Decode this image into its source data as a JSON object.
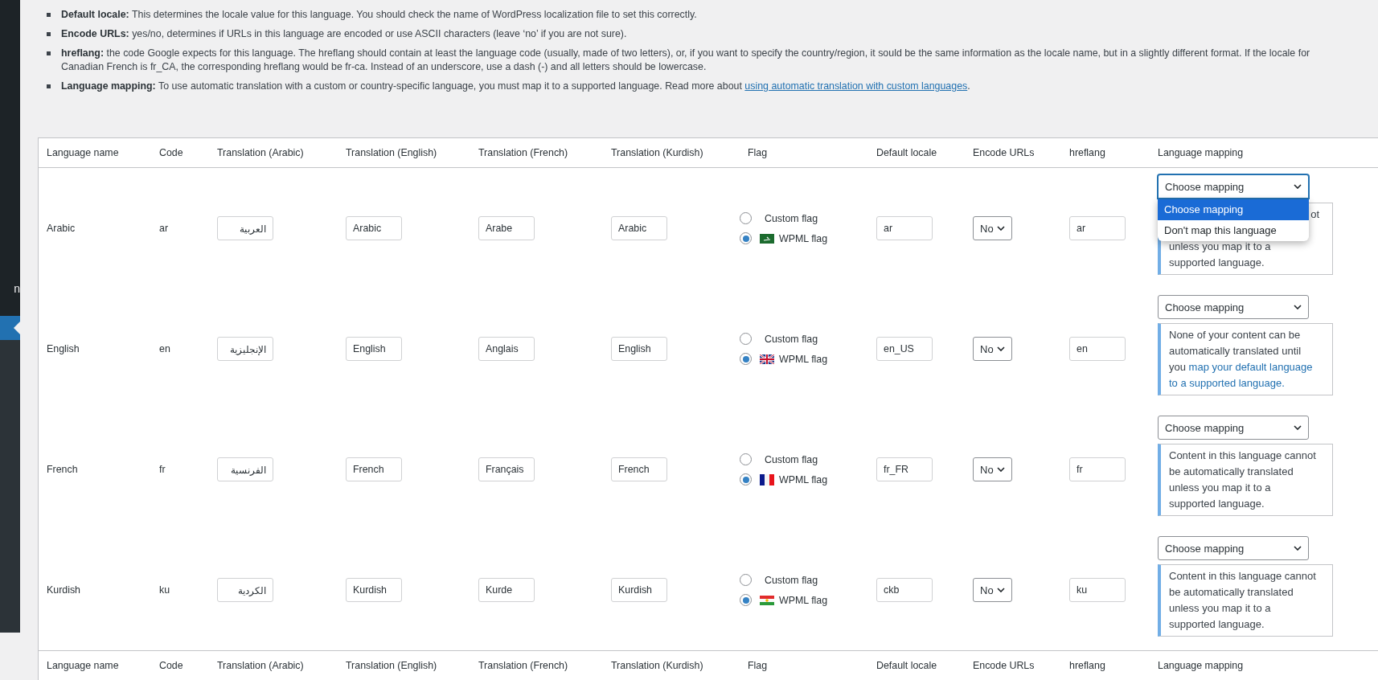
{
  "sidebar": {
    "items": [
      {
        "label": "n",
        "selected": false
      },
      {
        "selected": true
      }
    ]
  },
  "description": [
    {
      "term": "Default locale:",
      "text": "This determines the locale value for this language. You should check the name of WordPress localization file to set this correctly."
    },
    {
      "term": "Encode URLs:",
      "text": "yes/no, determines if URLs in this language are encoded or use ASCII characters (leave ‘no’ if you are not sure)."
    },
    {
      "term": "hreflang:",
      "text": "the code Google expects for this language. The hreflang should contain at least the language code (usually, made of two letters), or, if you want to specify the country/region, it sould be the same information as the locale name, but in a slightly different format. If the locale for\nCanadian French is fr_CA, the corresponding hreflang would be fr-ca. Instead of an underscore, use a dash (-) and all letters should be lowercase."
    },
    {
      "term": "Language mapping:",
      "text": "To use automatic translation with a custom or country-specific language, you must map it to a supported language. Read more about",
      "link": "using automatic translation with custom languages",
      "after": "."
    }
  ],
  "table": {
    "columns": [
      "Language name",
      "Code",
      "Translation (Arabic)",
      "Translation (English)",
      "Translation (French)",
      "Translation (Kurdish)",
      "Flag",
      "Default locale",
      "Encode URLs",
      "hreflang",
      "Language mapping"
    ],
    "rows": [
      {
        "name": "Arabic",
        "code": "ar",
        "translations": [
          "العربية",
          "Arabic",
          "Arabe",
          "Arabic"
        ],
        "flag_options": [
          {
            "label": "Custom flag",
            "selected": false
          },
          {
            "label": "WPML flag",
            "selected": true,
            "kind": "saudi"
          }
        ],
        "locale": "ar",
        "encode_urls": "No",
        "hreflang": "ar",
        "mapping": {
          "value": "Choose mapping",
          "focused": true,
          "open": true,
          "options": [
            {
              "label": "Choose mapping",
              "selected": true
            },
            {
              "label": "Don't map this language",
              "selected": false
            }
          ]
        },
        "note": {
          "fragment": "ot",
          "text": "unless you map it to a supported language."
        }
      },
      {
        "name": "English",
        "code": "en",
        "translations": [
          "الإنجليزية",
          "English",
          "Anglais",
          "English"
        ],
        "flag_options": [
          {
            "label": "Custom flag",
            "selected": false
          },
          {
            "label": "WPML flag",
            "selected": true,
            "kind": "uk"
          }
        ],
        "locale": "en_US",
        "encode_urls": "No",
        "hreflang": "en",
        "mapping": {
          "value": "Choose mapping",
          "focused": false
        },
        "note": {
          "text": "None of your content can be automatically translated until you",
          "link": [
            "map your default language",
            "to a supported language."
          ]
        }
      },
      {
        "name": "French",
        "code": "fr",
        "translations": [
          "الفرنسية",
          "French",
          "Français",
          "French"
        ],
        "flag_options": [
          {
            "label": "Custom flag",
            "selected": false
          },
          {
            "label": "WPML flag",
            "selected": true,
            "kind": "france"
          }
        ],
        "locale": "fr_FR",
        "encode_urls": "No",
        "hreflang": "fr",
        "mapping": {
          "value": "Choose mapping",
          "focused": false
        },
        "note": {
          "text": "Content in this language cannot be automatically translated unless you map it to a supported language."
        }
      },
      {
        "name": "Kurdish",
        "code": "ku",
        "translations": [
          "الكردية",
          "Kurdish",
          "Kurde",
          "Kurdish"
        ],
        "flag_options": [
          {
            "label": "Custom flag",
            "selected": false
          },
          {
            "label": "WPML flag",
            "selected": true,
            "kind": "kurdistan"
          }
        ],
        "locale": "ckb",
        "encode_urls": "No",
        "hreflang": "ku",
        "mapping": {
          "value": "Choose mapping",
          "focused": false
        },
        "note": {
          "text": "Content in this language cannot be automatically translated unless you map it to a supported language."
        }
      }
    ],
    "footer_columns": [
      "Language name",
      "Code",
      "Translation (Arabic)",
      "Translation (English)",
      "Translation (French)",
      "Translation (Kurdish)",
      "Flag",
      "Default locale",
      "Encode URLs",
      "hreflang",
      "Language mapping"
    ]
  }
}
